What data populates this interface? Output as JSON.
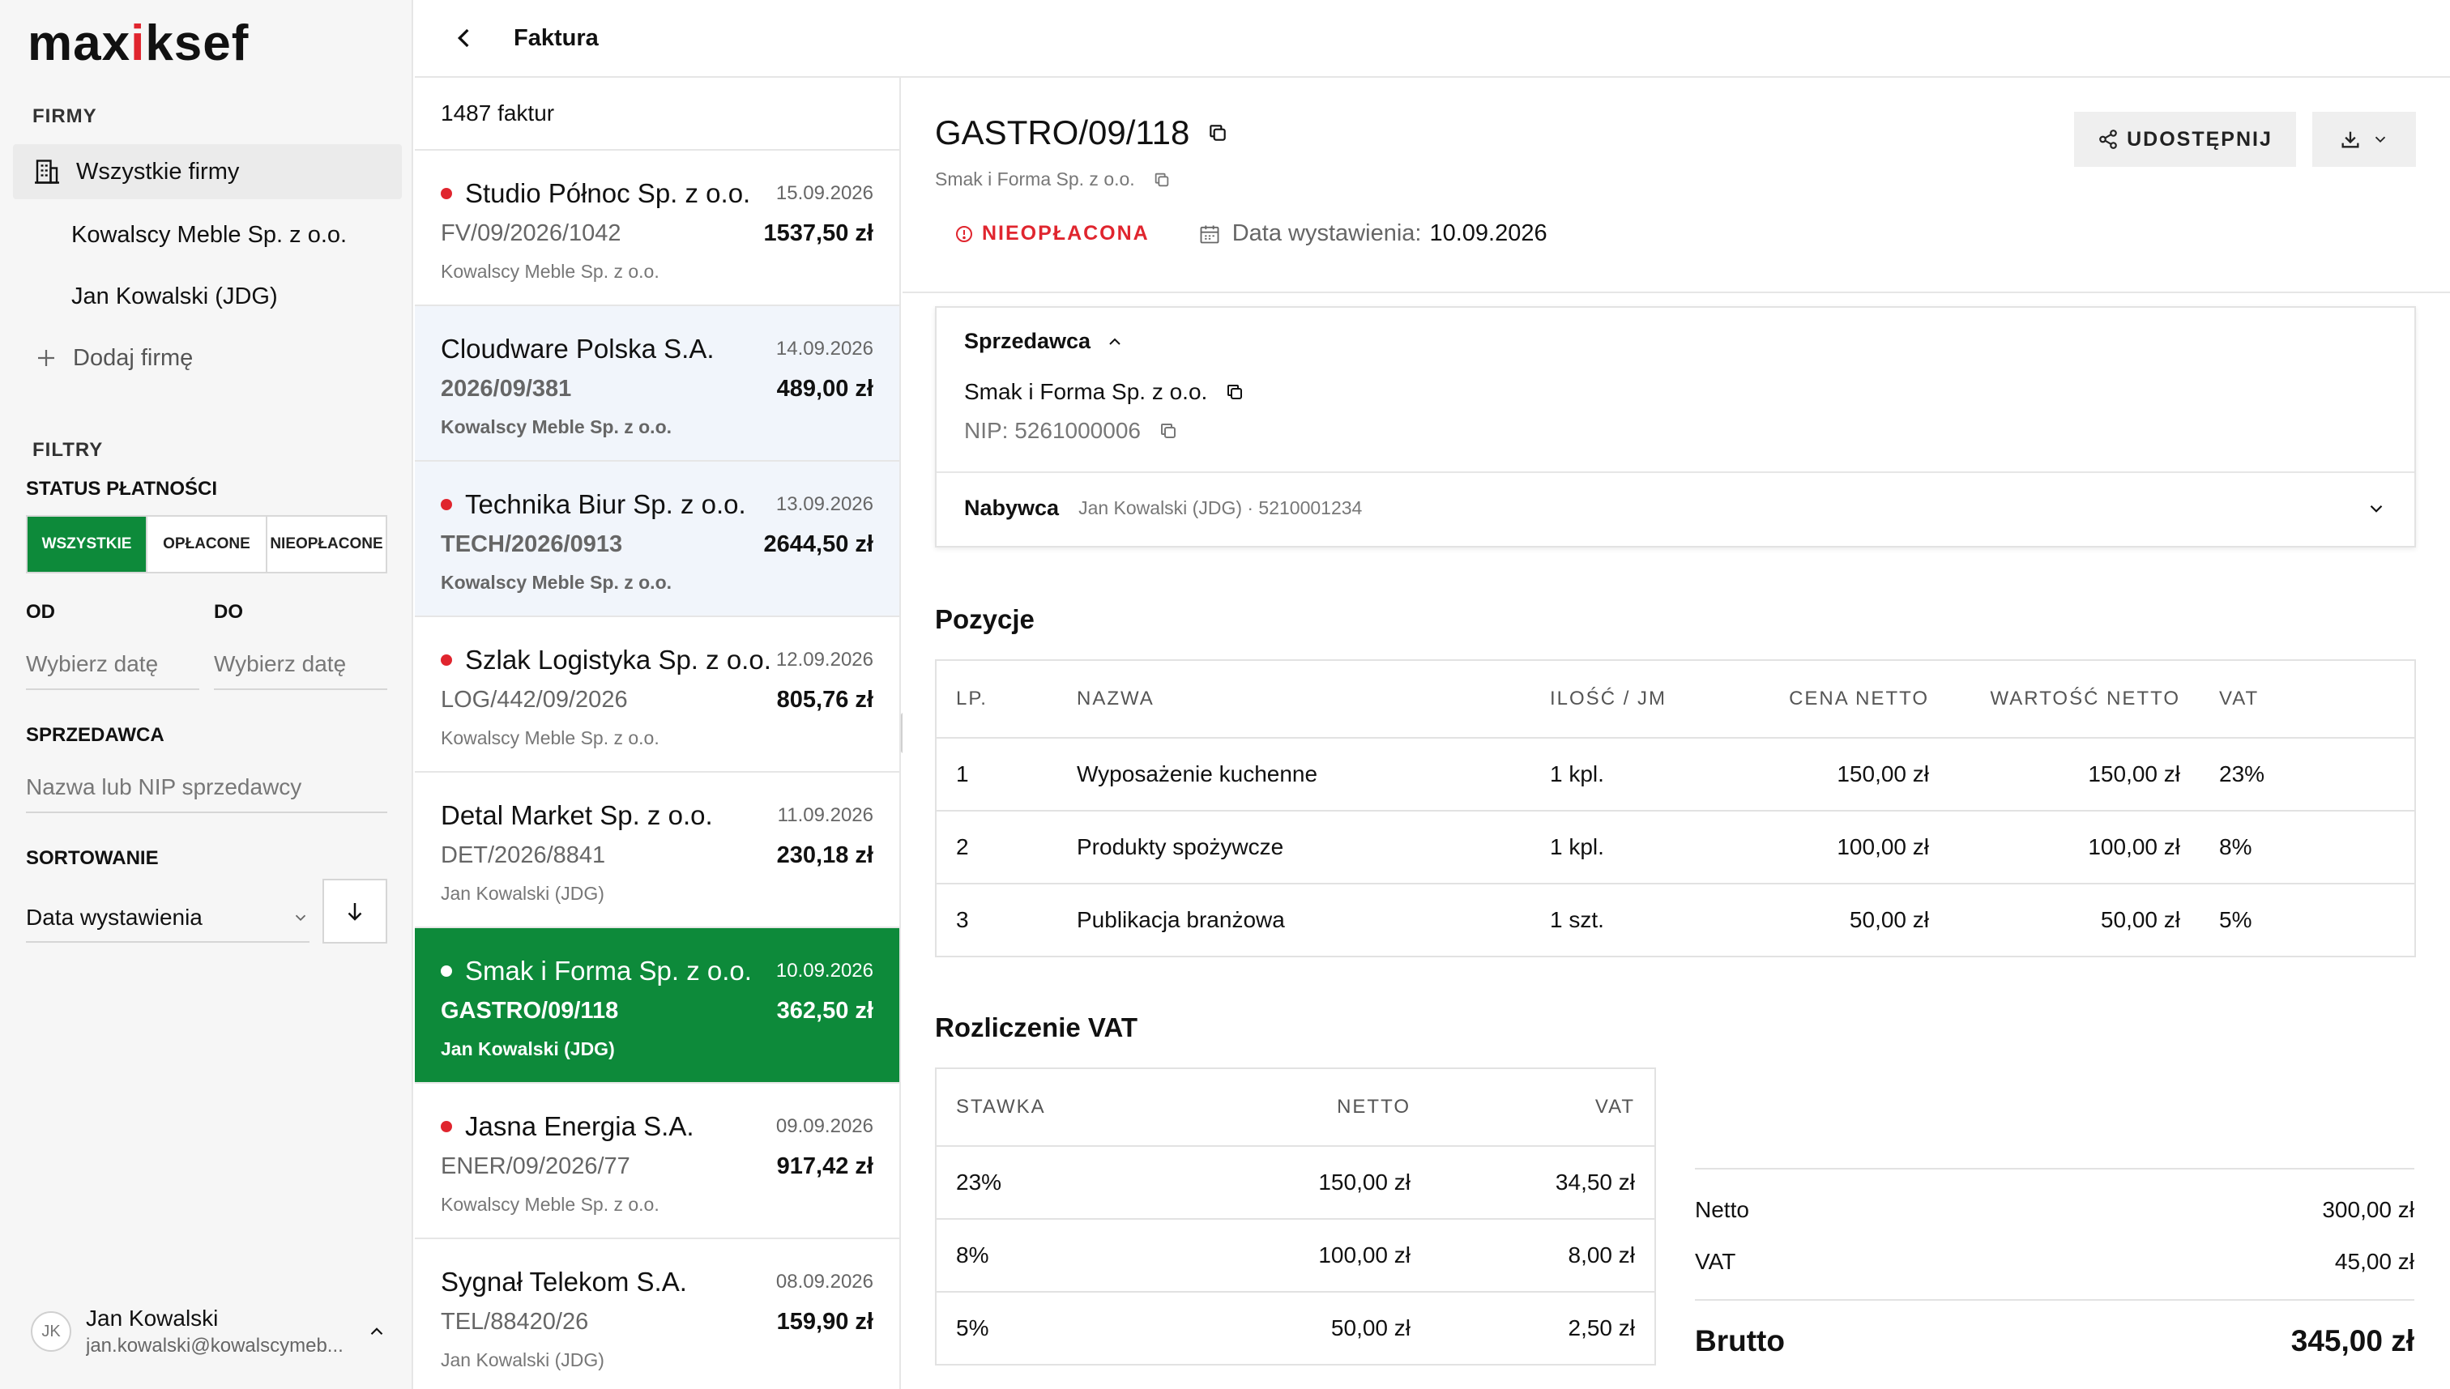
{
  "app": {
    "logo_left": "max",
    "logo_mid": "i",
    "logo_right": "ksef",
    "header_title": "Faktura",
    "brand_color": "#0d8a3a",
    "alert_color": "#e0252e"
  },
  "sidebar": {
    "firms_label": "FIRMY",
    "firms": [
      {
        "label": "Wszystkie firmy",
        "icon": "building-icon",
        "active": true
      },
      {
        "label": "Kowalscy Meble Sp. z o.o."
      },
      {
        "label": "Jan Kowalski (JDG)"
      }
    ],
    "add_firm_label": "Dodaj firmę",
    "filters_label": "FILTRY",
    "payment_status_label": "STATUS PŁATNOŚCI",
    "payment_status_options": [
      "WSZYSTKIE",
      "OPŁACONE",
      "NIEOPŁACONE"
    ],
    "from_label": "OD",
    "to_label": "DO",
    "from_placeholder": "Wybierz datę",
    "to_placeholder": "Wybierz datę",
    "seller_label": "SPRZEDAWCA",
    "seller_placeholder": "Nazwa lub NIP sprzedawcy",
    "sort_label": "SORTOWANIE",
    "sort_value": "Data wystawienia",
    "user": {
      "initials": "JK",
      "name": "Jan Kowalski",
      "email": "jan.kowalski@kowalscymeb..."
    }
  },
  "list": {
    "count_label": "1487 faktur",
    "invoices": [
      {
        "seller": "Studio Północ Sp. z o.o.",
        "date": "15.09.2026",
        "number": "FV/09/2026/1042",
        "amount": "1537,50 zł",
        "buyer": "Kowalscy Meble Sp. z o.o.",
        "unpaid": true
      },
      {
        "seller": "Cloudware Polska S.A.",
        "date": "14.09.2026",
        "number": "2026/09/381",
        "amount": "489,00 zł",
        "buyer": "Kowalscy Meble Sp. z o.o.",
        "unpaid": false
      },
      {
        "seller": "Technika Biur Sp. z o.o.",
        "date": "13.09.2026",
        "number": "TECH/2026/0913",
        "amount": "2644,50 zł",
        "buyer": "Kowalscy Meble Sp. z o.o.",
        "unpaid": true
      },
      {
        "seller": "Szlak Logistyka Sp. z o.o.",
        "date": "12.09.2026",
        "number": "LOG/442/09/2026",
        "amount": "805,76 zł",
        "buyer": "Kowalscy Meble Sp. z o.o.",
        "unpaid": true
      },
      {
        "seller": "Detal Market Sp. z o.o.",
        "date": "11.09.2026",
        "number": "DET/2026/8841",
        "amount": "230,18 zł",
        "buyer": "Jan Kowalski (JDG)",
        "unpaid": false
      },
      {
        "seller": "Smak i Forma Sp. z o.o.",
        "date": "10.09.2026",
        "number": "GASTRO/09/118",
        "amount": "362,50 zł",
        "buyer": "Jan Kowalski (JDG)",
        "unpaid": true
      },
      {
        "seller": "Jasna Energia S.A.",
        "date": "09.09.2026",
        "number": "ENER/09/2026/77",
        "amount": "917,42 zł",
        "buyer": "Kowalscy Meble Sp. z o.o.",
        "unpaid": true
      },
      {
        "seller": "Sygnał Telekom S.A.",
        "date": "08.09.2026",
        "number": "TEL/88420/26",
        "amount": "159,90 zł",
        "buyer": "Jan Kowalski (JDG)",
        "unpaid": false
      }
    ]
  },
  "detail": {
    "number": "GASTRO/09/118",
    "seller_short": "Smak i Forma Sp. z o.o.",
    "status": "NIEOPŁACONA",
    "issue_date_label": "Data wystawienia:",
    "issue_date": "10.09.2026",
    "share_label": "UDOSTĘPNIJ",
    "seller_section_label": "Sprzedawca",
    "seller_name": "Smak i Forma Sp. z o.o.",
    "seller_nip": "NIP: 5261000006",
    "buyer_section_label": "Nabywca",
    "buyer_value": "Jan Kowalski (JDG) · 5210001234",
    "items_title": "Pozycje",
    "items_headers": [
      "LP.",
      "NAZWA",
      "ILOŚĆ / JM",
      "CENA NETTO",
      "WARTOŚĆ NETTO",
      "VAT"
    ],
    "items": [
      [
        "1",
        "Wyposażenie kuchenne",
        "1 kpl.",
        "150,00 zł",
        "150,00 zł",
        "23%"
      ],
      [
        "2",
        "Produkty spożywcze",
        "1 kpl.",
        "100,00 zł",
        "100,00 zł",
        "8%"
      ],
      [
        "3",
        "Publikacja branżowa",
        "1 szt.",
        "50,00 zł",
        "50,00 zł",
        "5%"
      ]
    ],
    "vat_title": "Rozliczenie VAT",
    "vat_headers": [
      "STAWKA",
      "NETTO",
      "VAT"
    ],
    "vat_rows": [
      [
        "23%",
        "150,00 zł",
        "34,50 zł"
      ],
      [
        "8%",
        "100,00 zł",
        "8,00 zł"
      ],
      [
        "5%",
        "50,00 zł",
        "2,50 zł"
      ]
    ],
    "totals": {
      "netto_label": "Netto",
      "netto": "300,00 zł",
      "vat_label": "VAT",
      "vat": "45,00 zł",
      "brutto_label": "Brutto",
      "brutto": "345,00 zł"
    }
  }
}
